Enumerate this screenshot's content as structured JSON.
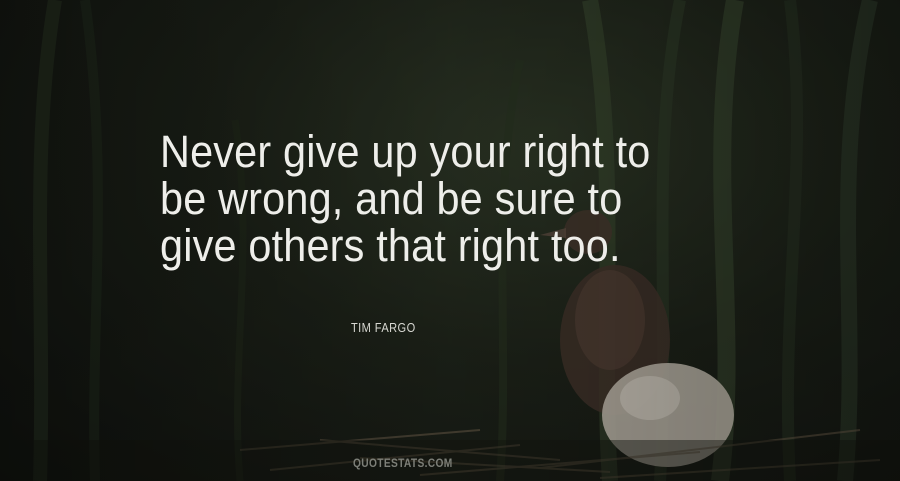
{
  "quote": {
    "lines": [
      "Never give up your right to",
      "be wrong, and be sure to",
      "give others that right too."
    ]
  },
  "author": "TIM FARGO",
  "watermark": "QUOTESTATS.COM",
  "background": {
    "subject": "chick-and-egg-in-grass-nest",
    "palette": [
      "#1c2118",
      "#2b3424",
      "#4a3a30",
      "#b9b2a6"
    ]
  }
}
